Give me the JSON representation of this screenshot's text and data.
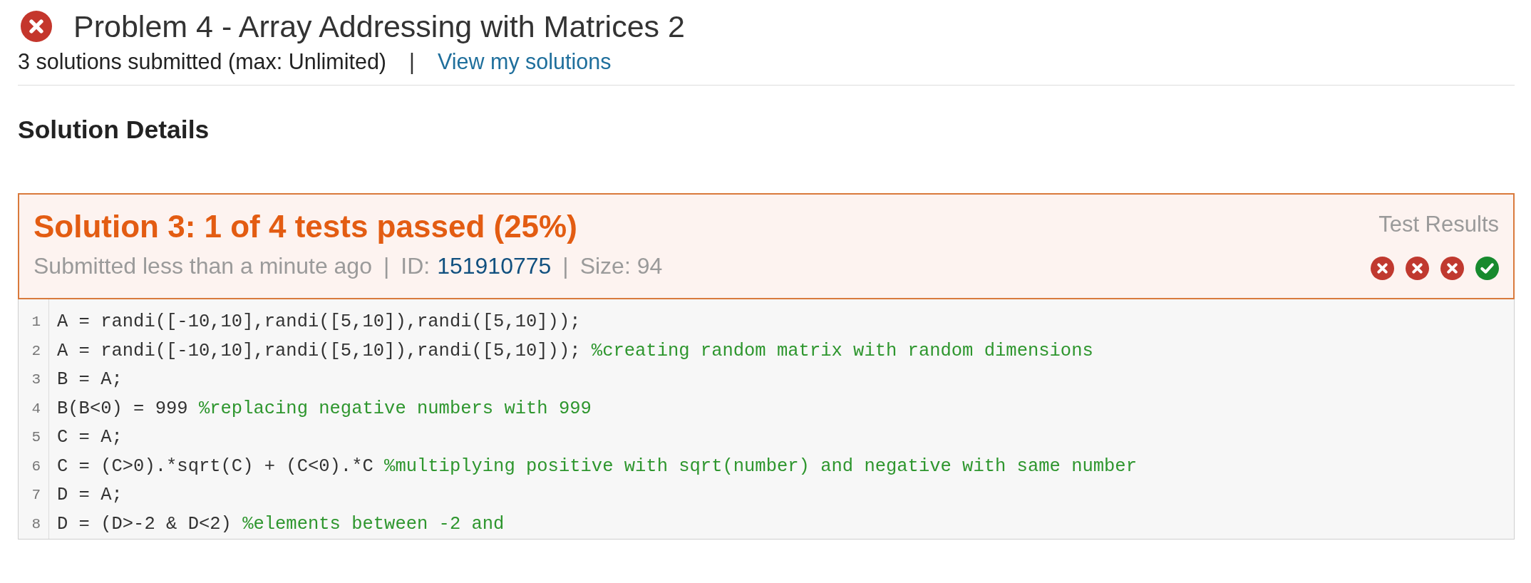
{
  "problem": {
    "passed": false,
    "title": "Problem 4 - Array Addressing with Matrices 2"
  },
  "submissions": {
    "text": "3 solutions submitted (max: Unlimited)",
    "separator": "|",
    "link": "View my solutions"
  },
  "section_title": "Solution Details",
  "solution": {
    "title": "Solution 3: 1 of 4 tests passed (25%)",
    "meta": [
      {
        "kind": "text",
        "text": "Submitted less than a minute ago"
      },
      {
        "kind": "separator",
        "text": "|"
      },
      {
        "kind": "id",
        "label": "ID:",
        "value": "151910775"
      },
      {
        "kind": "separator",
        "text": "|"
      },
      {
        "kind": "text",
        "text": "Size: 94"
      }
    ],
    "test_results": {
      "label": "Test Results",
      "tests": [
        {
          "passed": false
        },
        {
          "passed": false
        },
        {
          "passed": false
        },
        {
          "passed": true
        }
      ]
    }
  },
  "code": {
    "lines": [
      {
        "number": "1",
        "code": "A = randi([-10,10],randi([5,10]),randi([5,10]));"
      },
      {
        "number": "2",
        "code": "A = randi([-10,10],randi([5,10]),randi([5,10]));",
        "comment": "%creating random matrix with random dimensions"
      },
      {
        "number": "3",
        "code": "B = A;"
      },
      {
        "number": "4",
        "code": "B(B<0) = 999",
        "comment": "%replacing negative numbers with 999"
      },
      {
        "number": "5",
        "code": "C = A;"
      },
      {
        "number": "6",
        "code": "C = (C>0).*sqrt(C) + (C<0).*C",
        "comment": "%multiplying positive with sqrt(number) and negative with same number"
      },
      {
        "number": "7",
        "code": "D = A;"
      },
      {
        "number": "8",
        "code": "D = (D>-2 & D<2)",
        "comment": "%elements between -2 and"
      }
    ]
  }
}
